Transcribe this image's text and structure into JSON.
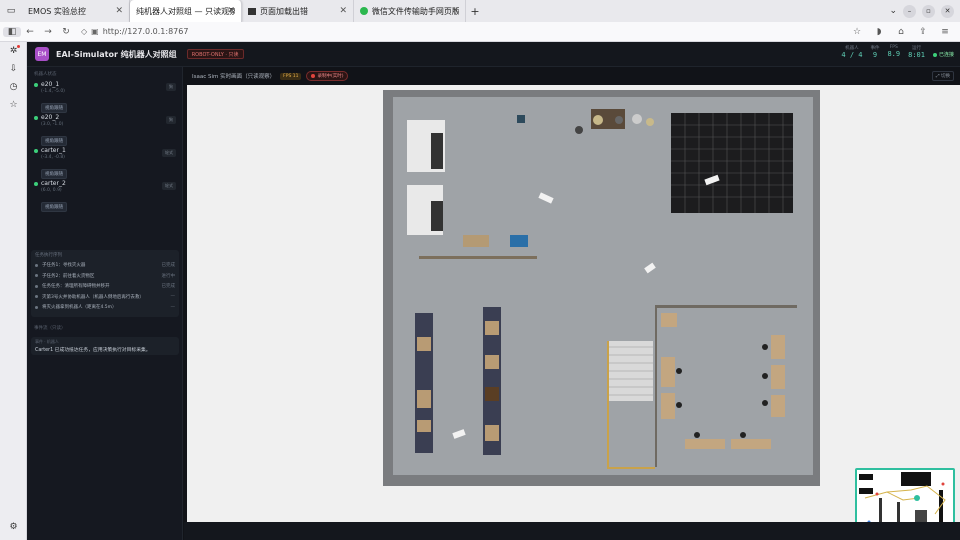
{
  "browser": {
    "tabs": [
      {
        "title": "EMOS 实验总控",
        "active": false
      },
      {
        "title": "纯机器人对照组 — 只读观察",
        "active": true
      },
      {
        "title": "页面加载出错",
        "active": false
      },
      {
        "title": "微信文件传输助手网页版",
        "active": false
      }
    ],
    "url": "http://127.0.0.1:8767",
    "new_tab": "+"
  },
  "app": {
    "logo": "EM",
    "title": "EAI-Simulator 纯机器人对照组",
    "readonly_badge": "ROBOT-ONLY · 只读",
    "stats": [
      {
        "label": "机器人",
        "value": "4 / 4"
      },
      {
        "label": "事件",
        "value": "9"
      },
      {
        "label": "FPS",
        "value": "8.9"
      },
      {
        "label": "运行",
        "value": "8:01"
      }
    ],
    "online": "已连接"
  },
  "sidebar": {
    "robots_label": "机器人状态",
    "robots": [
      {
        "name": "e20_1",
        "coord": "(-1.4, -5.0)",
        "tag": "狗",
        "button": "视角跟随"
      },
      {
        "name": "e20_2",
        "coord": "(3.0, -1.0)",
        "tag": "狗",
        "button": "视角跟随"
      },
      {
        "name": "carter_1",
        "coord": "(-3.4, -0.8)",
        "tag": "轮式",
        "button": "视角跟随"
      },
      {
        "name": "carter_2",
        "coord": "(6.0, 0.9)",
        "tag": "轮式",
        "button": "视角跟随"
      }
    ],
    "tasks_title": "任务执行序列",
    "tasks": [
      {
        "text": "子任务1：寻找灭火器",
        "status": "已完成"
      },
      {
        "text": "子任务2：前往着火货物区",
        "status": "进行中"
      },
      {
        "text": "任务任务：清理所有障碍物并移开",
        "status": "已完成"
      },
      {
        "text": "灭第3号火并协助机器人（机器人倒地后再行去救）",
        "status": "—"
      },
      {
        "text": "将灭火器拿到机器人（距离在4.5m）",
        "status": "—"
      }
    ],
    "events_label": "事件流（只读）",
    "event": {
      "meta": "事件 · 机器人",
      "text": "Carter1 已成功抵达任务，应用决策执行对目标采集。"
    }
  },
  "view": {
    "title": "Isaac Sim 实时画面（只读观察）",
    "fps_badge": "FPS 11",
    "rec": "录制中(实时)",
    "toggle": "⤢ 切换"
  },
  "colors": {
    "accent": "#2fbf9f",
    "logo": "#a84fc7",
    "danger": "#e0443c",
    "online": "#3ccf7a"
  }
}
